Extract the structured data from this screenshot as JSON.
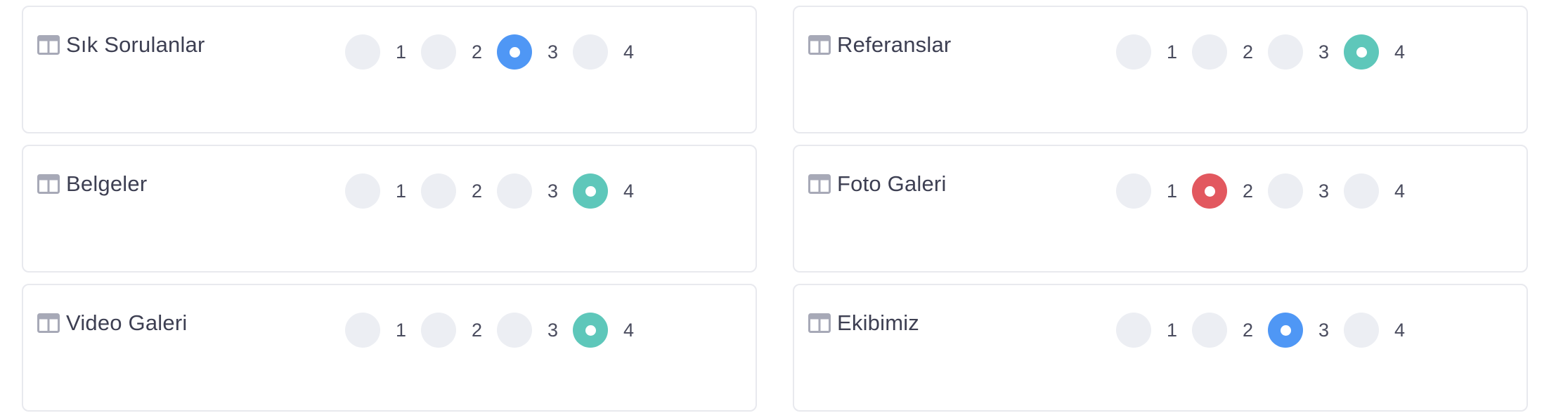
{
  "accent_colors": {
    "blue": "#4f97f5",
    "teal": "#5ec7ba",
    "red": "#e2585f"
  },
  "cards": [
    {
      "title": "Sık Sorulanlar",
      "icon": "layout-columns-icon",
      "options": [
        "1",
        "2",
        "3",
        "4"
      ],
      "selected": "3",
      "selected_color": "#4f97f5"
    },
    {
      "title": "Referanslar",
      "icon": "layout-columns-icon",
      "options": [
        "1",
        "2",
        "3",
        "4"
      ],
      "selected": "4",
      "selected_color": "#5ec7ba"
    },
    {
      "title": "Belgeler",
      "icon": "layout-columns-icon",
      "options": [
        "1",
        "2",
        "3",
        "4"
      ],
      "selected": "4",
      "selected_color": "#5ec7ba"
    },
    {
      "title": "Foto Galeri",
      "icon": "layout-columns-icon",
      "options": [
        "1",
        "2",
        "3",
        "4"
      ],
      "selected": "2",
      "selected_color": "#e2585f"
    },
    {
      "title": "Video Galeri",
      "icon": "layout-columns-icon",
      "options": [
        "1",
        "2",
        "3",
        "4"
      ],
      "selected": "4",
      "selected_color": "#5ec7ba"
    },
    {
      "title": "Ekibimiz",
      "icon": "layout-columns-icon",
      "options": [
        "1",
        "2",
        "3",
        "4"
      ],
      "selected": "3",
      "selected_color": "#4f97f5"
    }
  ]
}
